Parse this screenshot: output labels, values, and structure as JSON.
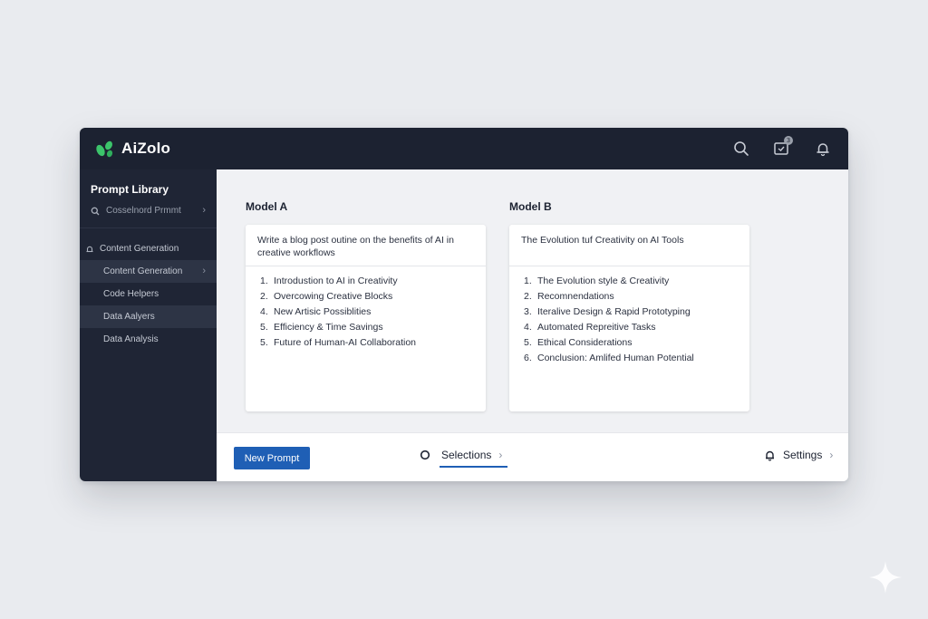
{
  "app": {
    "name": "AiZolo"
  },
  "topbar": {
    "icons": [
      "search-icon",
      "inbox-icon",
      "bell-icon"
    ],
    "inbox_badge": "3"
  },
  "sidebar": {
    "title": "Prompt Library",
    "items": [
      {
        "label": "Cosselnord Prmmt",
        "icon": "search-icon",
        "chevron": true
      },
      {
        "label": "Content Generation",
        "icon": "bell-icon",
        "chevron": false
      },
      {
        "label": "Content Generation",
        "chevron": true,
        "active": true
      },
      {
        "label": "Code Helpers"
      },
      {
        "label": "Data Aalyers",
        "active": true
      },
      {
        "label": "Data Analysis"
      }
    ]
  },
  "models": [
    {
      "title": "Model A",
      "prompt": "Write a blog post outine on the benefits of AI in creative workflows",
      "list": [
        "Introdustion to AI in Creativity",
        "Overcowing Creative Blocks",
        "New Artisic Possiblities",
        "Efficiency & Time Savings",
        "Future of Human-AI Collaboration"
      ],
      "numbers": [
        "1.",
        "2.",
        "4.",
        "5.",
        "5."
      ]
    },
    {
      "title": "Model B",
      "prompt": "The Evolution tuf Creativity on AI Tools",
      "list": [
        "The Evolution style & Creativity",
        "Recomnendations",
        "Iteralive Design & Rapid Prototyping",
        "Automated Repreitive Tasks",
        "Ethical Considerations",
        "Conclusion: Amlifed Human Potential"
      ],
      "numbers": [
        "1.",
        "2.",
        "3.",
        "4.",
        "5.",
        "6."
      ]
    }
  ],
  "footer": {
    "new_prompt": "New Prompt",
    "selections": "Selections",
    "settings": "Settings"
  },
  "colors": {
    "accent": "#1f5fb5",
    "topbar": "#1c2231",
    "sidebar": "#1f2535",
    "logo_green": "#3cc46b"
  }
}
